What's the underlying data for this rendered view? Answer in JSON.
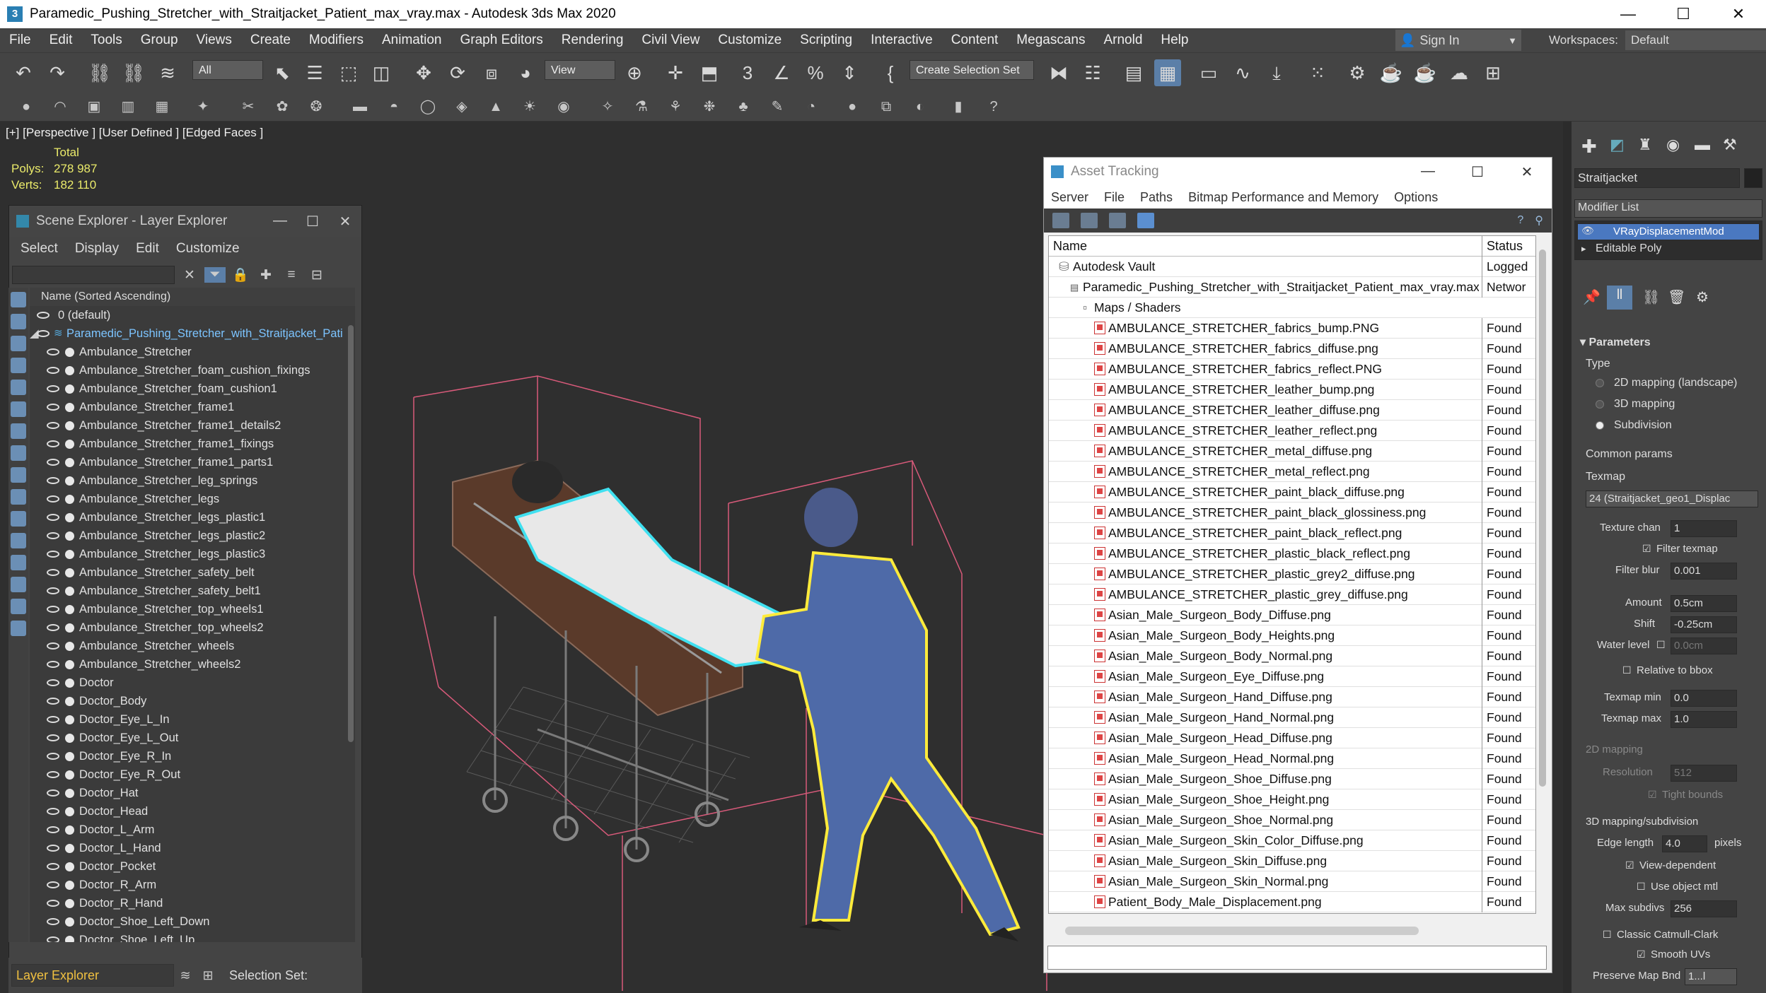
{
  "window": {
    "title": "Paramedic_Pushing_Stretcher_with_Straitjacket_Patient_max_vray.max - Autodesk 3ds Max 2020",
    "minimize": "—",
    "maximize": "☐",
    "close": "✕"
  },
  "menubar": [
    "File",
    "Edit",
    "Tools",
    "Group",
    "Views",
    "Create",
    "Modifiers",
    "Animation",
    "Graph Editors",
    "Rendering",
    "Civil View",
    "Customize",
    "Scripting",
    "Interactive",
    "Content",
    "Megascans",
    "Arnold",
    "Help"
  ],
  "signin": {
    "label": "Sign In"
  },
  "workspaces": {
    "label": "Workspaces:",
    "value": "Default"
  },
  "toolbar": {
    "filter": "All",
    "view": "View",
    "selection_set": "Create Selection Set"
  },
  "viewport": {
    "label": "[+] [Perspective ] [User Defined ] [Edged Faces ]",
    "stats": {
      "total_label": "Total",
      "polys_label": "Polys:",
      "polys": "278 987",
      "verts_label": "Verts:",
      "verts": "182 110"
    }
  },
  "scene_explorer": {
    "title": "Scene Explorer - Layer Explorer",
    "menu": [
      "Select",
      "Display",
      "Edit",
      "Customize"
    ],
    "column_header": "Name (Sorted Ascending)",
    "layer_default": "0 (default)",
    "layer_main": "Paramedic_Pushing_Stretcher_with_Straitjacket_Pati",
    "items": [
      "Ambulance_Stretcher",
      "Ambulance_Stretcher_foam_cushion_fixings",
      "Ambulance_Stretcher_foam_cushion1",
      "Ambulance_Stretcher_frame1",
      "Ambulance_Stretcher_frame1_details2",
      "Ambulance_Stretcher_frame1_fixings",
      "Ambulance_Stretcher_frame1_parts1",
      "Ambulance_Stretcher_leg_springs",
      "Ambulance_Stretcher_legs",
      "Ambulance_Stretcher_legs_plastic1",
      "Ambulance_Stretcher_legs_plastic2",
      "Ambulance_Stretcher_legs_plastic3",
      "Ambulance_Stretcher_safety_belt",
      "Ambulance_Stretcher_safety_belt1",
      "Ambulance_Stretcher_top_wheels1",
      "Ambulance_Stretcher_top_wheels2",
      "Ambulance_Stretcher_wheels",
      "Ambulance_Stretcher_wheels2",
      "Doctor",
      "Doctor_Body",
      "Doctor_Eye_L_In",
      "Doctor_Eye_L_Out",
      "Doctor_Eye_R_In",
      "Doctor_Eye_R_Out",
      "Doctor_Hat",
      "Doctor_Head",
      "Doctor_L_Arm",
      "Doctor_L_Hand",
      "Doctor_Pocket",
      "Doctor_R_Arm",
      "Doctor_R_Hand",
      "Doctor_Shoe_Left_Down",
      "Doctor_Shoe_Left_Up"
    ],
    "footer_label": "Layer Explorer",
    "selection_set": "Selection Set:"
  },
  "asset_tracking": {
    "title": "Asset Tracking",
    "menu": [
      "Server",
      "File",
      "Paths",
      "Bitmap Performance and Memory",
      "Options"
    ],
    "col_name": "Name",
    "col_status": "Status",
    "vault": {
      "name": "Autodesk Vault",
      "status": "Logged"
    },
    "file": {
      "name": "Paramedic_Pushing_Stretcher_with_Straitjacket_Patient_max_vray.max",
      "status": "Networ"
    },
    "maps_folder": "Maps / Shaders",
    "maps": [
      {
        "name": "AMBULANCE_STRETCHER_fabrics_bump.PNG",
        "status": "Found"
      },
      {
        "name": "AMBULANCE_STRETCHER_fabrics_diffuse.png",
        "status": "Found"
      },
      {
        "name": "AMBULANCE_STRETCHER_fabrics_reflect.PNG",
        "status": "Found"
      },
      {
        "name": "AMBULANCE_STRETCHER_leather_bump.png",
        "status": "Found"
      },
      {
        "name": "AMBULANCE_STRETCHER_leather_diffuse.png",
        "status": "Found"
      },
      {
        "name": "AMBULANCE_STRETCHER_leather_reflect.png",
        "status": "Found"
      },
      {
        "name": "AMBULANCE_STRETCHER_metal_diffuse.png",
        "status": "Found"
      },
      {
        "name": "AMBULANCE_STRETCHER_metal_reflect.png",
        "status": "Found"
      },
      {
        "name": "AMBULANCE_STRETCHER_paint_black_diffuse.png",
        "status": "Found"
      },
      {
        "name": "AMBULANCE_STRETCHER_paint_black_glossiness.png",
        "status": "Found"
      },
      {
        "name": "AMBULANCE_STRETCHER_paint_black_reflect.png",
        "status": "Found"
      },
      {
        "name": "AMBULANCE_STRETCHER_plastic_black_reflect.png",
        "status": "Found"
      },
      {
        "name": "AMBULANCE_STRETCHER_plastic_grey2_diffuse.png",
        "status": "Found"
      },
      {
        "name": "AMBULANCE_STRETCHER_plastic_grey_diffuse.png",
        "status": "Found"
      },
      {
        "name": "Asian_Male_Surgeon_Body_Diffuse.png",
        "status": "Found"
      },
      {
        "name": "Asian_Male_Surgeon_Body_Heights.png",
        "status": "Found"
      },
      {
        "name": "Asian_Male_Surgeon_Body_Normal.png",
        "status": "Found"
      },
      {
        "name": "Asian_Male_Surgeon_Eye_Diffuse.png",
        "status": "Found"
      },
      {
        "name": "Asian_Male_Surgeon_Hand_Diffuse.png",
        "status": "Found"
      },
      {
        "name": "Asian_Male_Surgeon_Hand_Normal.png",
        "status": "Found"
      },
      {
        "name": "Asian_Male_Surgeon_Head_Diffuse.png",
        "status": "Found"
      },
      {
        "name": "Asian_Male_Surgeon_Head_Normal.png",
        "status": "Found"
      },
      {
        "name": "Asian_Male_Surgeon_Shoe_Diffuse.png",
        "status": "Found"
      },
      {
        "name": "Asian_Male_Surgeon_Shoe_Height.png",
        "status": "Found"
      },
      {
        "name": "Asian_Male_Surgeon_Shoe_Normal.png",
        "status": "Found"
      },
      {
        "name": "Asian_Male_Surgeon_Skin_Color_Diffuse.png",
        "status": "Found"
      },
      {
        "name": "Asian_Male_Surgeon_Skin_Diffuse.png",
        "status": "Found"
      },
      {
        "name": "Asian_Male_Surgeon_Skin_Normal.png",
        "status": "Found"
      },
      {
        "name": "Patient_Body_Male_Displacement.png",
        "status": "Found"
      }
    ]
  },
  "command_panel": {
    "object_name": "Straitjacket",
    "modifier_list": "Modifier List",
    "stack": [
      "VRayDisplacementMod",
      "Editable Poly"
    ],
    "parameters": "Parameters",
    "type_label": "Type",
    "types": [
      "2D mapping (landscape)",
      "3D mapping",
      "Subdivision"
    ],
    "common_params": "Common params",
    "texmap_label": "Texmap",
    "texmap_value": "24 (Straitjacket_geo1_Displac",
    "texture_chan_label": "Texture chan",
    "texture_chan": "1",
    "filter_texmap": "Filter texmap",
    "filter_blur_label": "Filter blur",
    "filter_blur": "0.001",
    "amount_label": "Amount",
    "amount": "0.5cm",
    "shift_label": "Shift",
    "shift": "-0.25cm",
    "water_level_label": "Water level",
    "water_level": "0.0cm",
    "relative_bbox": "Relative to bbox",
    "texmap_min_label": "Texmap min",
    "texmap_min": "0.0",
    "texmap_max_label": "Texmap max",
    "texmap_max": "1.0",
    "mapping_2d": "2D mapping",
    "resolution_label": "Resolution",
    "resolution": "512",
    "tight_bounds": "Tight bounds",
    "mapping_3d": "3D mapping/subdivision",
    "edge_length_label": "Edge length",
    "edge_length": "4.0",
    "pixels": "pixels",
    "view_dependent": "View-dependent",
    "use_object_mtl": "Use object mtl",
    "max_subdivs_label": "Max subdivs",
    "max_subdivs": "256",
    "classic_catmull": "Classic Catmull-Clark",
    "smooth_uvs": "Smooth UVs",
    "preserve_map_label": "Preserve Map Bnd",
    "preserve_map": "1...l"
  }
}
